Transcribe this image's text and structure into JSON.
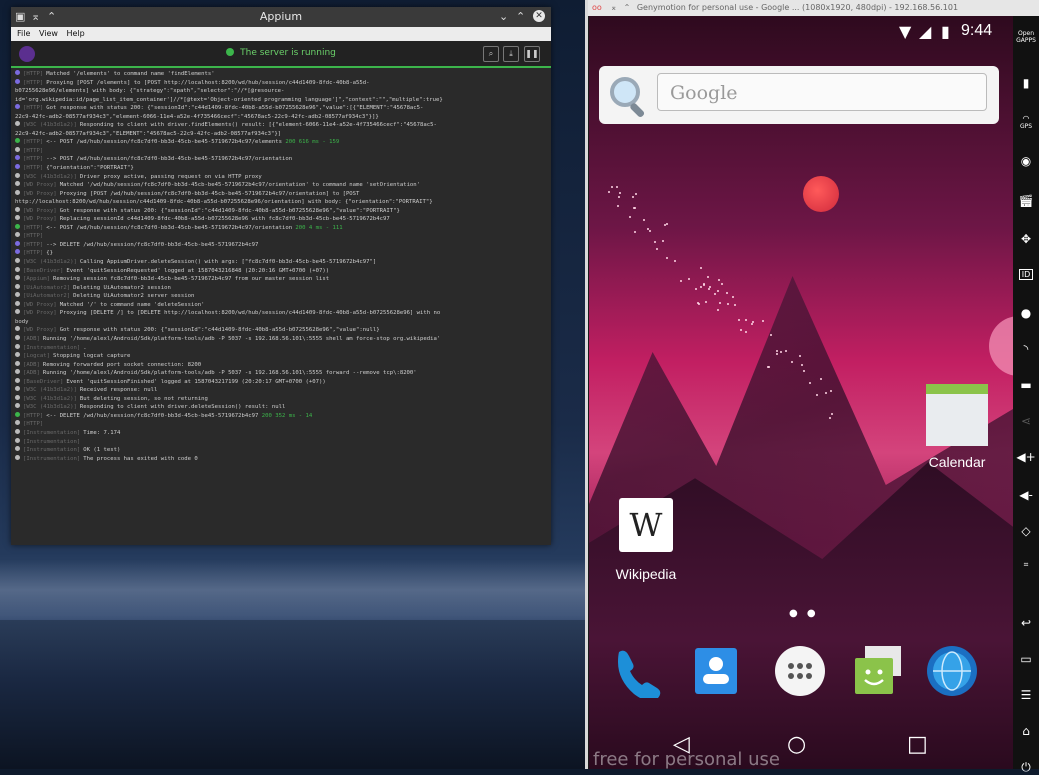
{
  "appium": {
    "title": "Appium",
    "menu": [
      "File",
      "View",
      "Help"
    ],
    "server_status": "The server is running",
    "header_buttons": [
      "search-icon",
      "download-icon",
      "pause-icon"
    ],
    "logs": [
      {
        "dot": "blue",
        "tag": "[HTTP]",
        "text": "Matched '/elements' to command name 'findElements'"
      },
      {
        "dot": "blue",
        "tag": "[HTTP]",
        "text": "Proxying [POST /elements] to [POST http://localhost:8200/wd/hub/session/c44d1409-8fdc-40b8-a55d-"
      },
      {
        "dot": "",
        "tag": "",
        "text": "b07255628e96/elements] with body: {\"strategy\":\"xpath\",\"selector\":\"//*[@resource-"
      },
      {
        "dot": "",
        "tag": "",
        "text": "id='org.wikipedia:id/page_list_item_container']//*[@text='Object-oriented programming language']\",\"context\":\"\",\"multiple\":true}"
      },
      {
        "dot": "blue",
        "tag": "[HTTP]",
        "text": "Got response with status 200: {\"sessionId\":\"c44d1409-8fdc-40b8-a55d-b07255628e96\",\"value\":[{\"ELEMENT\":\"45678ac5-"
      },
      {
        "dot": "",
        "tag": "",
        "text": "22c9-42fc-adb2-08577af934c3\",\"element-6066-11e4-a52e-4f735466cecf\":\"45678ac5-22c9-42fc-adb2-08577af934c3\"}]}"
      },
      {
        "dot": "",
        "tag": "[W3C (41b3d1a2)]",
        "text": "Responding to client with driver.findElements() result: [{\"element-6066-11e4-a52e-4f735466cecf\":\"45678ac5-"
      },
      {
        "dot": "",
        "tag": "",
        "text": "22c9-42fc-adb2-08577af934c3\",\"ELEMENT\":\"45678ac5-22c9-42fc-adb2-08577af934c3\"}]"
      },
      {
        "dot": "green",
        "tag": "[HTTP]",
        "text": "<-- POST /wd/hub/session/fc8c7df0-bb3d-45cb-be45-5719672b4c97/elements",
        "status": "200 616 ms - 159"
      },
      {
        "dot": "",
        "tag": "[HTTP]",
        "text": ""
      },
      {
        "dot": "blue",
        "tag": "[HTTP]",
        "text": "--> POST /wd/hub/session/fc8c7df0-bb3d-45cb-be45-5719672b4c97/orientation"
      },
      {
        "dot": "blue",
        "tag": "[HTTP]",
        "text": "{\"orientation\":\"PORTRAIT\"}"
      },
      {
        "dot": "",
        "tag": "[W3C (41b3d1a2)]",
        "text": "Driver proxy active, passing request on via HTTP proxy"
      },
      {
        "dot": "",
        "tag": "[WD Proxy]",
        "text": "Matched '/wd/hub/session/fc8c7df0-bb3d-45cb-be45-5719672b4c97/orientation' to command name 'setOrientation'"
      },
      {
        "dot": "",
        "tag": "[WD Proxy]",
        "text": "Proxying [POST /wd/hub/session/fc8c7df0-bb3d-45cb-be45-5719672b4c97/orientation] to [POST"
      },
      {
        "dot": "",
        "tag": "",
        "text": "http://localhost:8200/wd/hub/session/c44d1409-8fdc-40b8-a55d-b07255628e96/orientation] with body: {\"orientation\":\"PORTRAIT\"}"
      },
      {
        "dot": "",
        "tag": "[WD Proxy]",
        "text": "Got response with status 200: {\"sessionId\":\"c44d1409-8fdc-40b8-a55d-b07255628e96\",\"value\":\"PORTRAIT\"}"
      },
      {
        "dot": "",
        "tag": "[WD Proxy]",
        "text": "Replacing sessionId c44d1409-8fdc-40b8-a55d-b07255628e96 with fc8c7df0-bb3d-45cb-be45-5719672b4c97"
      },
      {
        "dot": "green",
        "tag": "[HTTP]",
        "text": "<-- POST /wd/hub/session/fc8c7df0-bb3d-45cb-be45-5719672b4c97/orientation",
        "status": "200 4 ms - 111"
      },
      {
        "dot": "",
        "tag": "[HTTP]",
        "text": ""
      },
      {
        "dot": "blue",
        "tag": "[HTTP]",
        "text": "--> DELETE /wd/hub/session/fc8c7df0-bb3d-45cb-be45-5719672b4c97"
      },
      {
        "dot": "blue",
        "tag": "[HTTP]",
        "text": "{}"
      },
      {
        "dot": "",
        "tag": "[W3C (41b3d1a2)]",
        "text": "Calling AppiumDriver.deleteSession() with args: [\"fc8c7df0-bb3d-45cb-be45-5719672b4c97\"]"
      },
      {
        "dot": "",
        "tag": "[BaseDriver]",
        "text": "Event 'quitSessionRequested' logged at 1587043216848 (20:20:16 GMT+0700 (+07))"
      },
      {
        "dot": "",
        "tag": "[Appium]",
        "text": "Removing session fc8c7df0-bb3d-45cb-be45-5719672b4c97 from our master session list"
      },
      {
        "dot": "",
        "tag": "[UiAutomator2]",
        "text": "Deleting UiAutomator2 session"
      },
      {
        "dot": "",
        "tag": "[UiAutomator2]",
        "text": "Deleting UiAutomator2 server session"
      },
      {
        "dot": "",
        "tag": "[WD Proxy]",
        "text": "Matched '/' to command name 'deleteSession'"
      },
      {
        "dot": "",
        "tag": "[WD Proxy]",
        "text": "Proxying [DELETE /] to [DELETE http://localhost:8200/wd/hub/session/c44d1409-8fdc-40b8-a55d-b07255628e96] with no"
      },
      {
        "dot": "",
        "tag": "",
        "text": "body"
      },
      {
        "dot": "",
        "tag": "[WD Proxy]",
        "text": "Got response with status 200: {\"sessionId\":\"c44d1409-8fdc-40b8-a55d-b07255628e96\",\"value\":null}"
      },
      {
        "dot": "",
        "tag": "[ADB]",
        "text": "Running '/home/alexl/Android/Sdk/platform-tools/adb -P 5037 -s 192.168.56.101\\:5555 shell am force-stop org.wikipedia'"
      },
      {
        "dot": "",
        "tag": "[Instrumentation]",
        "text": "."
      },
      {
        "dot": "",
        "tag": "[Logcat]",
        "text": "Stopping logcat capture"
      },
      {
        "dot": "",
        "tag": "[ADB]",
        "text": "Removing forwarded port socket connection: 8200"
      },
      {
        "dot": "",
        "tag": "[ADB]",
        "text": "Running '/home/alexl/Android/Sdk/platform-tools/adb -P 5037 -s 192.168.56.101\\:5555 forward --remove tcp\\:8200'"
      },
      {
        "dot": "",
        "tag": "[BaseDriver]",
        "text": "Event 'quitSessionFinished' logged at 1587043217199 (20:20:17 GMT+0700 (+07))"
      },
      {
        "dot": "",
        "tag": "[W3C (41b3d1a2)]",
        "text": "Received response: null"
      },
      {
        "dot": "",
        "tag": "[W3C (41b3d1a2)]",
        "text": "But deleting session, so not returning"
      },
      {
        "dot": "",
        "tag": "[W3C (41b3d1a2)]",
        "text": "Responding to client with driver.deleteSession() result: null"
      },
      {
        "dot": "green",
        "tag": "[HTTP]",
        "text": "<-- DELETE /wd/hub/session/fc8c7df0-bb3d-45cb-be45-5719672b4c97",
        "status": "200 352 ms - 14"
      },
      {
        "dot": "",
        "tag": "[HTTP]",
        "text": ""
      },
      {
        "dot": "",
        "tag": "[Instrumentation]",
        "text": "Time: 7.174"
      },
      {
        "dot": "",
        "tag": "[Instrumentation]",
        "text": ""
      },
      {
        "dot": "",
        "tag": "[Instrumentation]",
        "text": "OK (1 test)"
      },
      {
        "dot": "",
        "tag": "[Instrumentation]",
        "text": "The process has exited with code 0"
      }
    ]
  },
  "genymotion": {
    "title": "Genymotion for personal use - Google ... (1080x1920, 480dpi) - 192.168.56.101",
    "status_time": "9:44",
    "google_placeholder": "Google",
    "apps": {
      "calendar": "Calendar",
      "wikipedia": "Wikipedia"
    },
    "watermark": "free for personal use",
    "sidebar": {
      "open_gapps": "Open GAPPS",
      "gps": "GPS",
      "id": "ID"
    }
  }
}
